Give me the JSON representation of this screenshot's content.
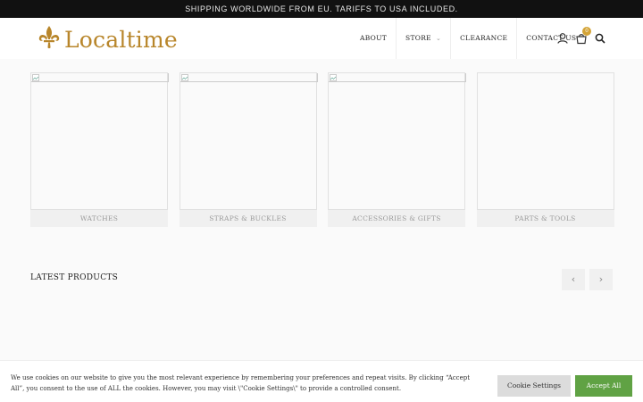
{
  "topbar": {
    "text": "SHIPPING WORLDWIDE FROM EU. TARIFFS TO USA INCLUDED."
  },
  "logo": {
    "text": "Localtime",
    "icon": "fleur-de-lis-icon",
    "color": "#b8862b"
  },
  "nav": {
    "items": [
      {
        "label": "ABOUT"
      },
      {
        "label": "STORE",
        "has_dropdown": true
      },
      {
        "label": "CLEARANCE"
      },
      {
        "label": "CONTACT US"
      }
    ]
  },
  "header_icons": {
    "account": "user-icon",
    "cart": "cart-icon",
    "cart_count": "0",
    "search": "search-icon"
  },
  "categories": [
    {
      "label": "WATCHES",
      "image_broken": true
    },
    {
      "label": "STRAPS & BUCKLES",
      "image_broken": true
    },
    {
      "label": "ACCESSORIES & GIFTS",
      "image_broken": true
    },
    {
      "label": "PARTS & TOOLS",
      "image_broken": false
    }
  ],
  "latest": {
    "title": "LATEST PRODUCTS",
    "prev_icon": "chevron-left-icon",
    "next_icon": "chevron-right-icon"
  },
  "cookie": {
    "text": "We use cookies on our website to give you the most relevant experience by remembering your preferences and repeat visits. By clicking “Accept All”, you consent to the use of ALL the cookies. However, you may visit \\\"Cookie Settings\\\" to provide a controlled consent.",
    "settings_label": "Cookie Settings",
    "accept_label": "Accept All",
    "accept_color": "#60a244"
  },
  "colors": {
    "brand_gold": "#b8862b",
    "badge": "#d4a437",
    "topbar_bg": "#111111"
  }
}
